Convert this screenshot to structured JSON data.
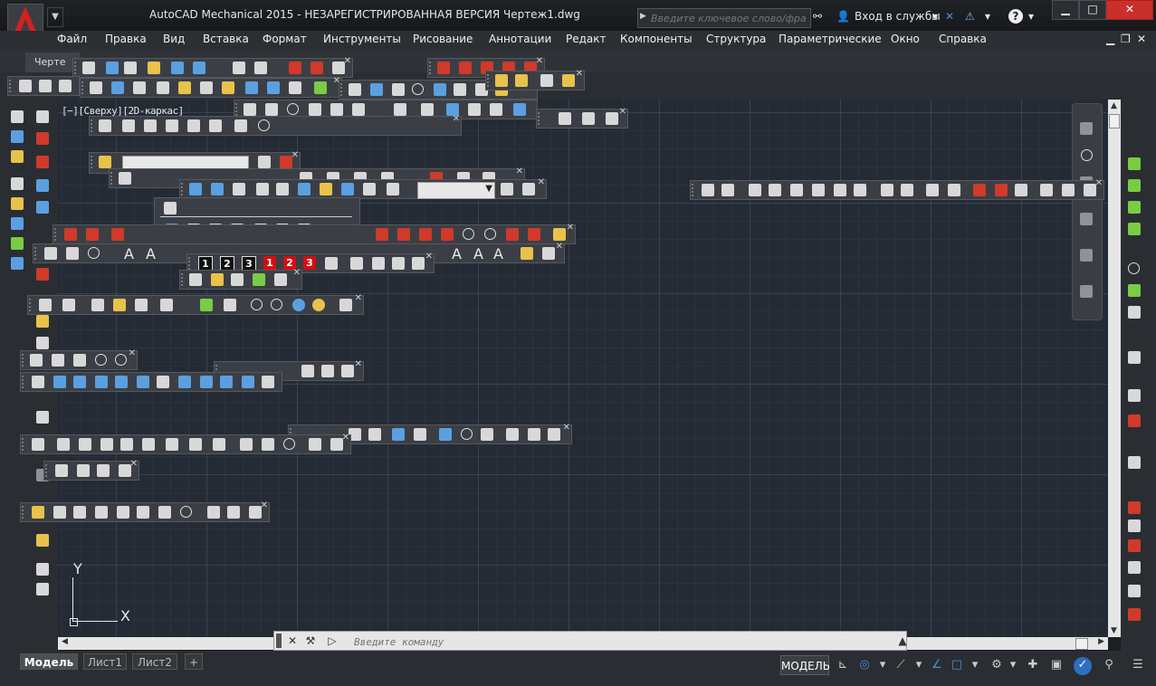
{
  "app": {
    "title": "AutoCAD Mechanical 2015 - НЕЗАРЕГИСТРИРОВАННАЯ ВЕРСИЯ     Чертеж1.dwg",
    "logo_letter": "M",
    "search_placeholder": "Введите ключевое слово/фразу",
    "sign_in": "Вход в службы",
    "help": "?"
  },
  "menu": [
    "Файл",
    "Правка",
    "Вид",
    "Вставка",
    "Формат",
    "Инструменты",
    "Рисование",
    "Аннотации",
    "Редакт",
    "Компоненты",
    "Структура",
    "Параметрические",
    "Окно",
    "Справка"
  ],
  "doc_tab": "Черте",
  "viewport_label": "[−][Сверху][2D-каркас]",
  "ucs": {
    "y": "Y",
    "x": "X"
  },
  "command_line": {
    "placeholder": "Введите команду"
  },
  "layout_tabs": [
    "Модель",
    "Лист1",
    "Лист2",
    "+"
  ],
  "status": {
    "model": "МОДЕЛЬ"
  },
  "toolbar_labels": {
    "numbers_black": [
      "1",
      "2",
      "3"
    ],
    "numbers_red": [
      "1",
      "2",
      "3"
    ],
    "text_a": "A"
  }
}
